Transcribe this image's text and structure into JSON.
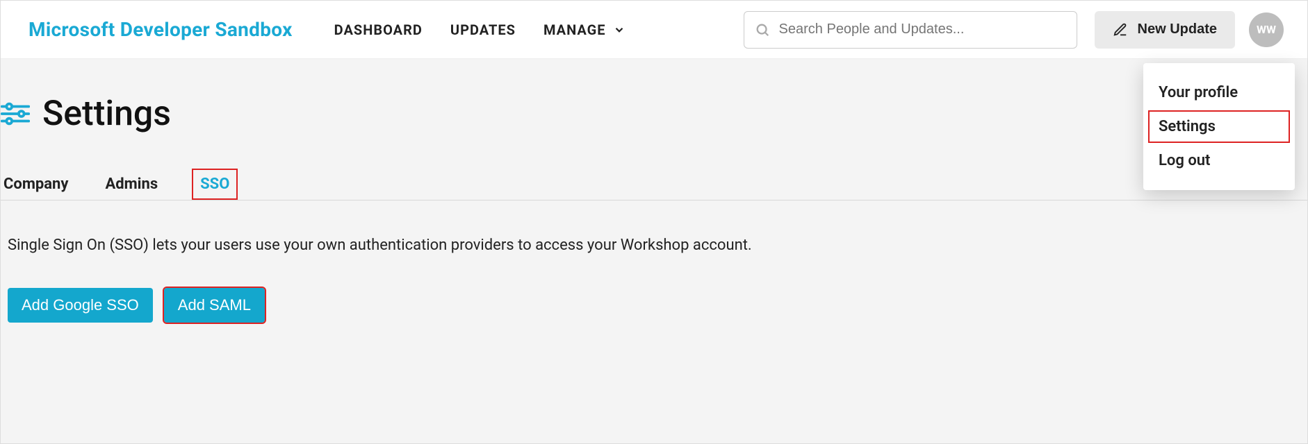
{
  "brand": "Microsoft Developer Sandbox",
  "nav": {
    "dashboard": "DASHBOARD",
    "updates": "UPDATES",
    "manage": "MANAGE"
  },
  "search": {
    "placeholder": "Search People and Updates..."
  },
  "new_update": "New Update",
  "avatar_initials": "WW",
  "page_title": "Settings",
  "tabs": {
    "company": "Company",
    "admins": "Admins",
    "sso": "SSO"
  },
  "sso": {
    "description": "Single Sign On (SSO) lets your users use your own authentication providers to access your Workshop account.",
    "add_google": "Add Google SSO",
    "add_saml": "Add SAML"
  },
  "dropdown": {
    "profile": "Your profile",
    "settings": "Settings",
    "logout": "Log out"
  }
}
